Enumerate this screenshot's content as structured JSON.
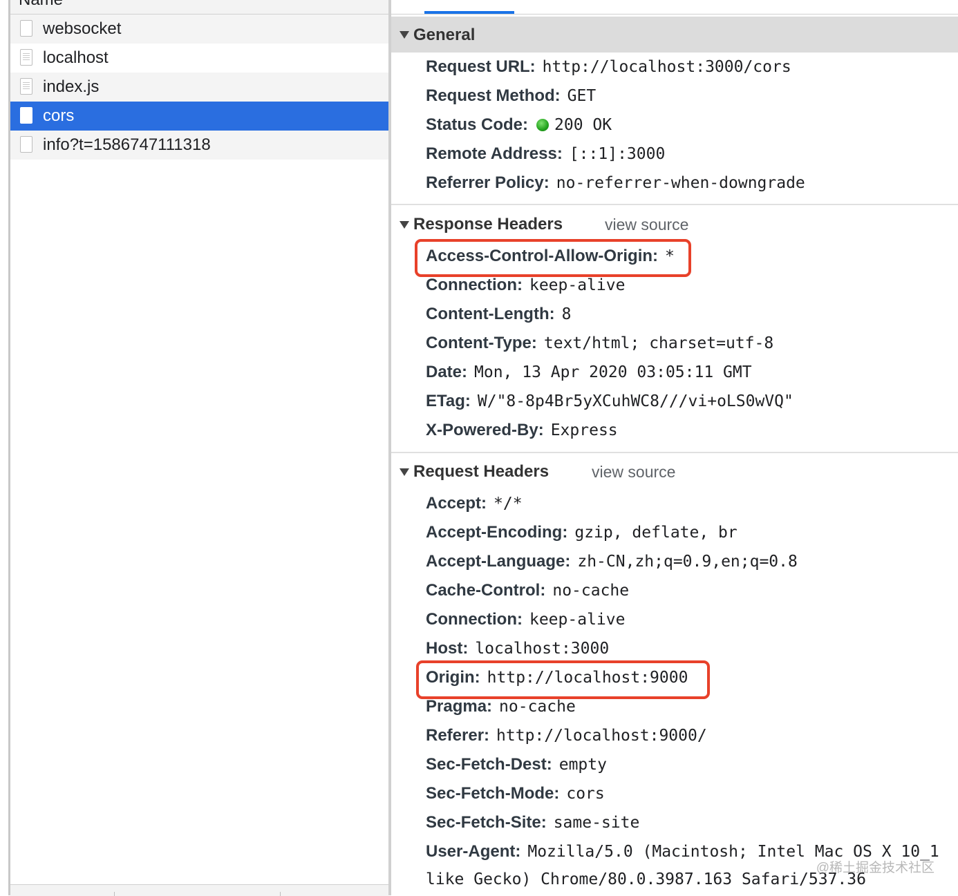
{
  "list": {
    "header": "Name",
    "items": [
      {
        "label": "websocket",
        "icon": "blank-file-icon"
      },
      {
        "label": "localhost",
        "icon": "document-icon"
      },
      {
        "label": "index.js",
        "icon": "script-file-icon"
      },
      {
        "label": "cors",
        "icon": "blank-file-icon",
        "selected": true
      },
      {
        "label": "info?t=1586747111318",
        "icon": "blank-file-icon"
      }
    ]
  },
  "general": {
    "title": "General",
    "rows": [
      {
        "key": "Request URL:",
        "value": "http://localhost:3000/cors"
      },
      {
        "key": "Request Method:",
        "value": "GET"
      },
      {
        "key": "Status Code:",
        "value": "200 OK"
      },
      {
        "key": "Remote Address:",
        "value": "[::1]:3000"
      },
      {
        "key": "Referrer Policy:",
        "value": "no-referrer-when-downgrade"
      }
    ]
  },
  "response_headers": {
    "title": "Response Headers",
    "view_source": "view source",
    "rows": [
      {
        "key": "Access-Control-Allow-Origin:",
        "value": "*"
      },
      {
        "key": "Connection:",
        "value": "keep-alive"
      },
      {
        "key": "Content-Length:",
        "value": "8"
      },
      {
        "key": "Content-Type:",
        "value": "text/html; charset=utf-8"
      },
      {
        "key": "Date:",
        "value": "Mon, 13 Apr 2020 03:05:11 GMT"
      },
      {
        "key": "ETag:",
        "value": "W/\"8-8p4Br5yXCuhWC8///vi+oLS0wVQ\""
      },
      {
        "key": "X-Powered-By:",
        "value": "Express"
      }
    ]
  },
  "request_headers": {
    "title": "Request Headers",
    "view_source": "view source",
    "rows": [
      {
        "key": "Accept:",
        "value": "*/*"
      },
      {
        "key": "Accept-Encoding:",
        "value": "gzip, deflate, br"
      },
      {
        "key": "Accept-Language:",
        "value": "zh-CN,zh;q=0.9,en;q=0.8"
      },
      {
        "key": "Cache-Control:",
        "value": "no-cache"
      },
      {
        "key": "Connection:",
        "value": "keep-alive"
      },
      {
        "key": "Host:",
        "value": "localhost:3000"
      },
      {
        "key": "Origin:",
        "value": "http://localhost:9000"
      },
      {
        "key": "Pragma:",
        "value": "no-cache"
      },
      {
        "key": "Referer:",
        "value": "http://localhost:9000/"
      },
      {
        "key": "Sec-Fetch-Dest:",
        "value": "empty"
      },
      {
        "key": "Sec-Fetch-Mode:",
        "value": "cors"
      },
      {
        "key": "Sec-Fetch-Site:",
        "value": "same-site"
      },
      {
        "key": "User-Agent:",
        "value": "Mozilla/5.0 (Macintosh; Intel Mac OS X 10_1"
      }
    ],
    "user_agent_continuation": "like Gecko) Chrome/80.0.3987.163 Safari/537.36"
  },
  "watermark": "@稀土掘金技术社区",
  "colors": {
    "selected_row": "#2a6ee0",
    "highlight_box": "#e8412a",
    "status_ok": "#22a21d",
    "tab_indicator": "#1a73e8"
  }
}
